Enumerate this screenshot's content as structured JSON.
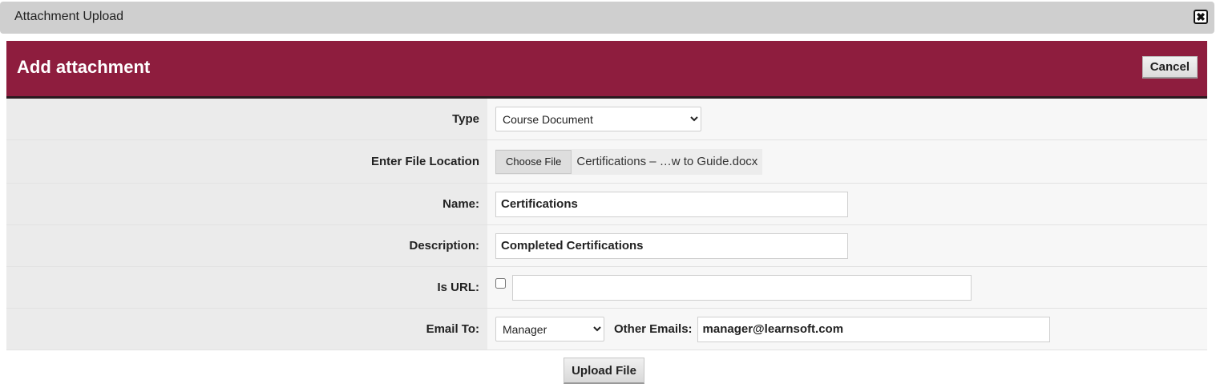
{
  "dialog": {
    "title": "Attachment Upload",
    "close_symbol": "✖"
  },
  "panel": {
    "title": "Add attachment",
    "cancel_label": "Cancel",
    "accent_color": "#8e1d3e"
  },
  "form": {
    "type": {
      "label": "Type",
      "selected": "Course Document"
    },
    "file": {
      "label": "Enter File Location",
      "button_label": "Choose File",
      "file_name": "Certifications – …w to Guide.docx"
    },
    "name": {
      "label": "Name:",
      "value": "Certifications"
    },
    "description": {
      "label": "Description:",
      "value": "Completed Certifications"
    },
    "is_url": {
      "label": "Is URL:",
      "checked": false,
      "value": ""
    },
    "email_to": {
      "label": "Email To:",
      "selected": "Manager",
      "other_label": "Other Emails:",
      "other_value": "manager@learnsoft.com"
    }
  },
  "upload_label": "Upload File"
}
